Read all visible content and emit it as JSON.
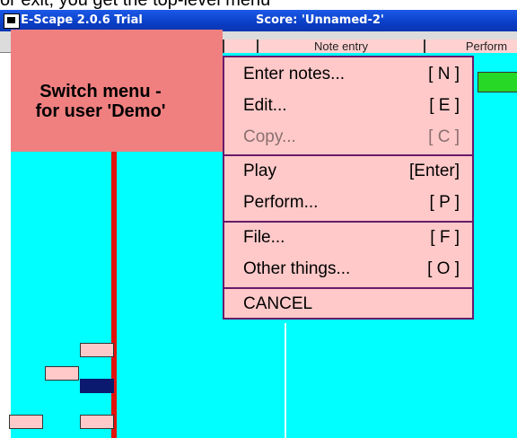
{
  "caption_partial": "or exit, you get the top-level menu",
  "window": {
    "app_title": "E-Scape 2.0.6 Trial",
    "score_title": "Score: 'Unnamed-2'"
  },
  "tabs": [
    {
      "label": "Note entry"
    },
    {
      "label": "Perform"
    }
  ],
  "user_panel": {
    "line1": "Switch menu -",
    "line2": "for user 'Demo'"
  },
  "menu": {
    "items": [
      {
        "label": "Enter notes...",
        "key": "[ N ]"
      },
      {
        "label": "Edit...",
        "key": "[ E ]"
      },
      {
        "label": "Copy...",
        "key": "[ C ]"
      },
      {
        "label": "Play",
        "key": "[Enter]"
      },
      {
        "label": "Perform...",
        "key": "[ P ]"
      },
      {
        "label": "File...",
        "key": "[ F ]"
      },
      {
        "label": "Other things...",
        "key": "[ O ]"
      },
      {
        "label": "CANCEL",
        "key": ""
      }
    ]
  },
  "colors": {
    "background": "#00ffff",
    "menu_bg": "#ffc9c9",
    "menu_border": "#6a1a6a",
    "panel_bg": "#f08080",
    "titlebar": "#0a3ec6",
    "playhead": "#e2130a",
    "selected_note": "#0b1a6e"
  }
}
